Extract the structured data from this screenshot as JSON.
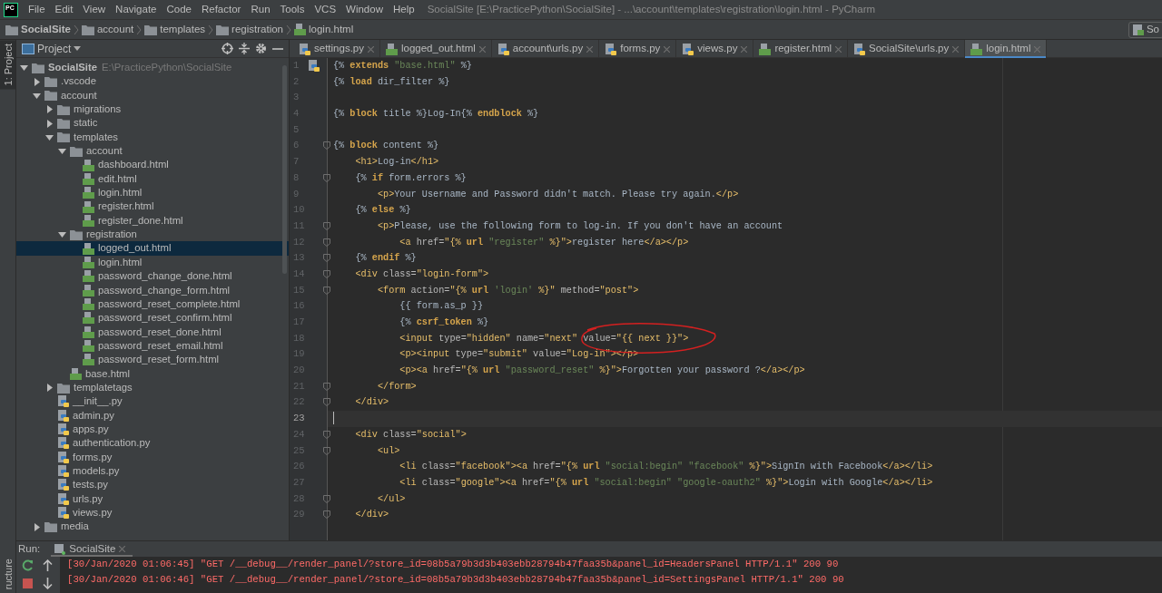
{
  "app": {
    "logo": "PC",
    "menu": [
      "File",
      "Edit",
      "View",
      "Navigate",
      "Code",
      "Refactor",
      "Run",
      "Tools",
      "VCS",
      "Window",
      "Help"
    ],
    "title": "SocialSite [E:\\PracticePython\\SocialSite] - ...\\account\\templates\\registration\\login.html - PyCharm"
  },
  "breadcrumb": [
    {
      "label": "SocialSite",
      "kind": "root"
    },
    {
      "label": "account",
      "kind": "folder"
    },
    {
      "label": "templates",
      "kind": "folder"
    },
    {
      "label": "registration",
      "kind": "folder"
    },
    {
      "label": "login.html",
      "kind": "html"
    }
  ],
  "run_config": "So",
  "tool_strip": {
    "top": "1: Project",
    "bottom": "ructure"
  },
  "project": {
    "title": "Project",
    "tree": [
      {
        "label": "SocialSite",
        "path": "E:\\PracticePython\\SocialSite",
        "kind": "folder",
        "expanded": true,
        "selected": false,
        "children": [
          {
            "label": ".vscode",
            "kind": "folder",
            "expanded": false,
            "selected": false
          },
          {
            "label": "account",
            "kind": "folder",
            "expanded": true,
            "selected": false,
            "children": [
              {
                "label": "migrations",
                "kind": "folder",
                "expanded": false,
                "selected": false
              },
              {
                "label": "static",
                "kind": "folder",
                "expanded": false,
                "selected": false
              },
              {
                "label": "templates",
                "kind": "folder",
                "expanded": true,
                "selected": false,
                "children": [
                  {
                    "label": "account",
                    "kind": "folder",
                    "expanded": true,
                    "selected": false,
                    "children": [
                      {
                        "label": "dashboard.html",
                        "kind": "html",
                        "selected": false
                      },
                      {
                        "label": "edit.html",
                        "kind": "html",
                        "selected": false
                      },
                      {
                        "label": "login.html",
                        "kind": "html",
                        "selected": false
                      },
                      {
                        "label": "register.html",
                        "kind": "html",
                        "selected": false
                      },
                      {
                        "label": "register_done.html",
                        "kind": "html",
                        "selected": false
                      }
                    ]
                  },
                  {
                    "label": "registration",
                    "kind": "folder",
                    "expanded": true,
                    "selected": false,
                    "children": [
                      {
                        "label": "logged_out.html",
                        "kind": "html",
                        "selected": true
                      },
                      {
                        "label": "login.html",
                        "kind": "html",
                        "selected": false
                      },
                      {
                        "label": "password_change_done.html",
                        "kind": "html",
                        "selected": false
                      },
                      {
                        "label": "password_change_form.html",
                        "kind": "html",
                        "selected": false
                      },
                      {
                        "label": "password_reset_complete.html",
                        "kind": "html",
                        "selected": false
                      },
                      {
                        "label": "password_reset_confirm.html",
                        "kind": "html",
                        "selected": false
                      },
                      {
                        "label": "password_reset_done.html",
                        "kind": "html",
                        "selected": false
                      },
                      {
                        "label": "password_reset_email.html",
                        "kind": "html",
                        "selected": false
                      },
                      {
                        "label": "password_reset_form.html",
                        "kind": "html",
                        "selected": false
                      }
                    ]
                  },
                  {
                    "label": "base.html",
                    "kind": "html",
                    "selected": false
                  }
                ]
              },
              {
                "label": "templatetags",
                "kind": "folder",
                "expanded": false,
                "selected": false
              },
              {
                "label": "__init__.py",
                "kind": "py",
                "selected": false
              },
              {
                "label": "admin.py",
                "kind": "py",
                "selected": false
              },
              {
                "label": "apps.py",
                "kind": "py",
                "selected": false
              },
              {
                "label": "authentication.py",
                "kind": "py",
                "selected": false
              },
              {
                "label": "forms.py",
                "kind": "py",
                "selected": false
              },
              {
                "label": "models.py",
                "kind": "py",
                "selected": false
              },
              {
                "label": "tests.py",
                "kind": "py",
                "selected": false
              },
              {
                "label": "urls.py",
                "kind": "py",
                "selected": false
              },
              {
                "label": "views.py",
                "kind": "py",
                "selected": false
              }
            ]
          },
          {
            "label": "media",
            "kind": "folder",
            "expanded": false,
            "selected": false
          }
        ]
      }
    ]
  },
  "editor": {
    "tabs": [
      {
        "label": "settings.py",
        "kind": "py",
        "selected": false
      },
      {
        "label": "logged_out.html",
        "kind": "html",
        "selected": false
      },
      {
        "label": "account\\urls.py",
        "kind": "py",
        "selected": false
      },
      {
        "label": "forms.py",
        "kind": "py",
        "selected": false
      },
      {
        "label": "views.py",
        "kind": "py",
        "selected": false
      },
      {
        "label": "register.html",
        "kind": "html",
        "selected": false
      },
      {
        "label": "SocialSite\\urls.py",
        "kind": "py",
        "selected": false
      },
      {
        "label": "login.html",
        "kind": "html",
        "selected": true
      }
    ],
    "lines": [
      {
        "number": "1",
        "current": false,
        "fold": false,
        "segs": [
          {
            "kind": "plain",
            "text": "{% "
          },
          {
            "kind": "keyword",
            "text": "extends"
          },
          {
            "kind": "string",
            "text": " \"base.html\""
          },
          {
            "kind": "plain",
            "text": " %}"
          }
        ]
      },
      {
        "number": "2",
        "current": false,
        "fold": false,
        "segs": [
          {
            "kind": "plain",
            "text": "{% "
          },
          {
            "kind": "keyword",
            "text": "load"
          },
          {
            "kind": "plain",
            "text": " dir_filter %}"
          }
        ]
      },
      {
        "number": "3",
        "current": false,
        "fold": false
      },
      {
        "number": "4",
        "current": false,
        "fold": false,
        "segs": [
          {
            "kind": "plain",
            "text": "{% "
          },
          {
            "kind": "keyword",
            "text": "block"
          },
          {
            "kind": "plain",
            "text": " title %}Log-In{% "
          },
          {
            "kind": "keyword",
            "text": "endblock"
          },
          {
            "kind": "plain",
            "text": " %}"
          }
        ]
      },
      {
        "number": "5",
        "current": false,
        "fold": false
      },
      {
        "number": "6",
        "current": false,
        "fold": true,
        "segs": [
          {
            "kind": "plain",
            "text": "{% "
          },
          {
            "kind": "keyword",
            "text": "block"
          },
          {
            "kind": "plain",
            "text": " content %}"
          }
        ]
      },
      {
        "number": "7",
        "current": false,
        "fold": false,
        "segs": [
          {
            "kind": "tag",
            "text": "    <h1>"
          },
          {
            "kind": "plain",
            "text": "Log-in"
          },
          {
            "kind": "tag",
            "text": "</h1>"
          }
        ]
      },
      {
        "number": "8",
        "current": false,
        "fold": true,
        "segs": [
          {
            "kind": "plain",
            "text": "    {% "
          },
          {
            "kind": "keyword",
            "text": "if"
          },
          {
            "kind": "plain",
            "text": " form.errors %}"
          }
        ]
      },
      {
        "number": "9",
        "current": false,
        "fold": false,
        "segs": [
          {
            "kind": "tag",
            "text": "        <p>"
          },
          {
            "kind": "plain",
            "text": "Your Username and Password didn't match. Please try again."
          },
          {
            "kind": "tag",
            "text": "</p>"
          }
        ]
      },
      {
        "number": "10",
        "current": false,
        "fold": false,
        "segs": [
          {
            "kind": "plain",
            "text": "    {% "
          },
          {
            "kind": "keyword",
            "text": "else"
          },
          {
            "kind": "plain",
            "text": " %}"
          }
        ]
      },
      {
        "number": "11",
        "current": false,
        "fold": true,
        "segs": [
          {
            "kind": "tag",
            "text": "        <p>"
          },
          {
            "kind": "plain",
            "text": "Please, use the following form to log-in. If you don't have an account"
          }
        ]
      },
      {
        "number": "12",
        "current": false,
        "fold": true,
        "segs": [
          {
            "kind": "tag",
            "text": "            <a "
          },
          {
            "kind": "attr",
            "text": "href="
          },
          {
            "kind": "tag",
            "text": "\"{% "
          },
          {
            "kind": "keyword",
            "text": "url"
          },
          {
            "kind": "string",
            "text": " \"register\""
          },
          {
            "kind": "tag",
            "text": " %}\">"
          },
          {
            "kind": "plain",
            "text": "register here"
          },
          {
            "kind": "tag",
            "text": "</a></p>"
          }
        ]
      },
      {
        "number": "13",
        "current": false,
        "fold": true,
        "segs": [
          {
            "kind": "plain",
            "text": "    {% "
          },
          {
            "kind": "keyword",
            "text": "endif"
          },
          {
            "kind": "plain",
            "text": " %}"
          }
        ]
      },
      {
        "number": "14",
        "current": false,
        "fold": true,
        "segs": [
          {
            "kind": "tag",
            "text": "    <div "
          },
          {
            "kind": "attr",
            "text": "class="
          },
          {
            "kind": "tag",
            "text": "\"login-form\">"
          }
        ]
      },
      {
        "number": "15",
        "current": false,
        "fold": true,
        "segs": [
          {
            "kind": "tag",
            "text": "        <form "
          },
          {
            "kind": "attr",
            "text": "action="
          },
          {
            "kind": "tag",
            "text": "\"{% "
          },
          {
            "kind": "keyword",
            "text": "url"
          },
          {
            "kind": "string",
            "text": " 'login'"
          },
          {
            "kind": "tag",
            "text": " %}\" "
          },
          {
            "kind": "attr",
            "text": "method="
          },
          {
            "kind": "tag",
            "text": "\"post\">"
          }
        ]
      },
      {
        "number": "16",
        "current": false,
        "fold": false,
        "segs": [
          {
            "kind": "plain",
            "text": "            {{ form.as_p }}"
          }
        ]
      },
      {
        "number": "17",
        "current": false,
        "fold": false,
        "segs": [
          {
            "kind": "plain",
            "text": "            {% "
          },
          {
            "kind": "keyword",
            "text": "csrf_token"
          },
          {
            "kind": "plain",
            "text": " %}"
          }
        ]
      },
      {
        "number": "18",
        "current": false,
        "fold": false,
        "segs": [
          {
            "kind": "tag",
            "text": "            <input "
          },
          {
            "kind": "attr",
            "text": "type="
          },
          {
            "kind": "tag",
            "text": "\"hidden\" "
          },
          {
            "kind": "attr",
            "text": "name="
          },
          {
            "kind": "tag",
            "text": "\"next\" "
          },
          {
            "kind": "attr",
            "text": "value="
          },
          {
            "kind": "tag",
            "text": "\"{{ next }}\">"
          }
        ]
      },
      {
        "number": "19",
        "current": false,
        "fold": false,
        "segs": [
          {
            "kind": "tag",
            "text": "            <p><input "
          },
          {
            "kind": "attr",
            "text": "type="
          },
          {
            "kind": "tag",
            "text": "\"submit\" "
          },
          {
            "kind": "attr",
            "text": "value="
          },
          {
            "kind": "tag",
            "text": "\"Log-in\"></p>"
          }
        ]
      },
      {
        "number": "20",
        "current": false,
        "fold": false,
        "segs": [
          {
            "kind": "tag",
            "text": "            <p><a "
          },
          {
            "kind": "attr",
            "text": "href="
          },
          {
            "kind": "tag",
            "text": "\"{% "
          },
          {
            "kind": "keyword",
            "text": "url"
          },
          {
            "kind": "string",
            "text": " \"password_reset\""
          },
          {
            "kind": "tag",
            "text": " %}\">"
          },
          {
            "kind": "plain",
            "text": "Forgotten your password ?"
          },
          {
            "kind": "tag",
            "text": "</a></p>"
          }
        ]
      },
      {
        "number": "21",
        "current": false,
        "fold": true,
        "segs": [
          {
            "kind": "tag",
            "text": "        </form>"
          }
        ]
      },
      {
        "number": "22",
        "current": false,
        "fold": true,
        "segs": [
          {
            "kind": "tag",
            "text": "    </div>"
          }
        ]
      },
      {
        "number": "23",
        "current": true,
        "fold": false
      },
      {
        "number": "24",
        "current": false,
        "fold": true,
        "segs": [
          {
            "kind": "tag",
            "text": "    <div "
          },
          {
            "kind": "attr",
            "text": "class="
          },
          {
            "kind": "tag",
            "text": "\"social\">"
          }
        ]
      },
      {
        "number": "25",
        "current": false,
        "fold": true,
        "segs": [
          {
            "kind": "tag",
            "text": "        <ul>"
          }
        ]
      },
      {
        "number": "26",
        "current": false,
        "fold": false,
        "segs": [
          {
            "kind": "tag",
            "text": "            <li "
          },
          {
            "kind": "attr",
            "text": "class="
          },
          {
            "kind": "tag",
            "text": "\"facebook\"><a "
          },
          {
            "kind": "attr",
            "text": "href="
          },
          {
            "kind": "tag",
            "text": "\"{% "
          },
          {
            "kind": "keyword",
            "text": "url"
          },
          {
            "kind": "string",
            "text": " \"social:begin\" \"facebook\""
          },
          {
            "kind": "tag",
            "text": " %}\">"
          },
          {
            "kind": "plain",
            "text": "SignIn with Facebook"
          },
          {
            "kind": "tag",
            "text": "</a></li>"
          }
        ]
      },
      {
        "number": "27",
        "current": false,
        "fold": false,
        "segs": [
          {
            "kind": "tag",
            "text": "            <li "
          },
          {
            "kind": "attr",
            "text": "class="
          },
          {
            "kind": "tag",
            "text": "\"google\"><a "
          },
          {
            "kind": "attr",
            "text": "href="
          },
          {
            "kind": "tag",
            "text": "\"{% "
          },
          {
            "kind": "keyword",
            "text": "url"
          },
          {
            "kind": "string",
            "text": " \"social:begin\" \"google-oauth2\""
          },
          {
            "kind": "tag",
            "text": " %}\">"
          },
          {
            "kind": "plain",
            "text": "Login with Google"
          },
          {
            "kind": "tag",
            "text": "</a></li>"
          }
        ]
      },
      {
        "number": "28",
        "current": false,
        "fold": true,
        "segs": [
          {
            "kind": "tag",
            "text": "        </ul>"
          }
        ]
      },
      {
        "number": "29",
        "current": false,
        "fold": true,
        "segs": [
          {
            "kind": "tag",
            "text": "    </div>"
          }
        ]
      }
    ]
  },
  "run": {
    "label": "Run:",
    "tab": "SocialSite",
    "log": [
      "[30/Jan/2020 01:06:45] \"GET /__debug__/render_panel/?store_id=08b5a79b3d3b403ebb28794b47faa35b&panel_id=HeadersPanel HTTP/1.1\" 200 90",
      "[30/Jan/2020 01:06:46] \"GET /__debug__/render_panel/?store_id=08b5a79b3d3b403ebb28794b47faa35b&panel_id=SettingsPanel HTTP/1.1\" 200 90"
    ]
  }
}
